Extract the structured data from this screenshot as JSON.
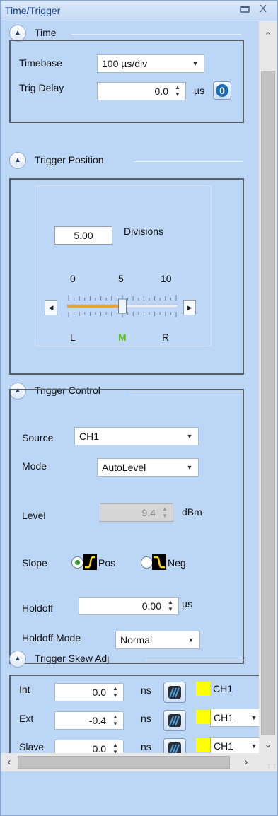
{
  "window": {
    "title": "Time/Trigger",
    "pin_icon": "pin-icon",
    "close_icon": "close-icon",
    "close_glyph": "X"
  },
  "time": {
    "header": "Time",
    "timebase_label": "Timebase",
    "timebase_value": "100  µs/div",
    "trig_delay_label": "Trig Delay",
    "trig_delay_value": "0.0",
    "trig_delay_unit": "µs",
    "zero_button": "0"
  },
  "trigger_position": {
    "header": "Trigger Position",
    "divisions_value": "5.00",
    "divisions_label": "Divisions",
    "scale_top": [
      "0",
      "5",
      "10"
    ],
    "scale_bottom": [
      "L",
      "M",
      "R"
    ],
    "slider_position_divisions": 5.0,
    "slider_range": [
      0,
      10
    ]
  },
  "trigger_control": {
    "header": "Trigger Control",
    "source_label": "Source",
    "source_value": "CH1",
    "mode_label": "Mode",
    "mode_value": "AutoLevel",
    "level_label": "Level",
    "level_value": "9.4",
    "level_unit": "dBm",
    "slope_label": "Slope",
    "slope_pos": "Pos",
    "slope_neg": "Neg",
    "slope_selected": "Pos",
    "holdoff_label": "Holdoff",
    "holdoff_value": "0.00",
    "holdoff_unit": "µs",
    "holdoff_mode_label": "Holdoff Mode",
    "holdoff_mode_value": "Normal"
  },
  "trigger_skew": {
    "header": "Trigger Skew Adj",
    "rows": [
      {
        "label": "Int",
        "value": "0.0",
        "unit": "ns",
        "channel": "CH1",
        "has_dropdown": false
      },
      {
        "label": "Ext",
        "value": "-0.4",
        "unit": "ns",
        "channel": "CH1",
        "has_dropdown": true
      },
      {
        "label": "Slave",
        "value": "0.0",
        "unit": "ns",
        "channel": "CH1",
        "has_dropdown": true
      }
    ]
  },
  "colors": {
    "panel_bg": "#bcd6f6",
    "title_text": "#15428b",
    "accent_blue": "#1a6fb8",
    "marker_green": "#5fc21e",
    "slider_fill": "#e8a040",
    "channel_yellow": "#ffff00"
  }
}
